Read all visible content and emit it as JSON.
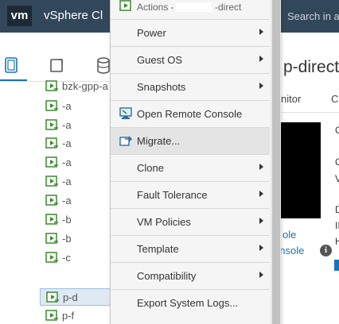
{
  "app": {
    "logo_text": "vm",
    "name": "vSphere Cl",
    "search_placeholder": "Search in a"
  },
  "nav": {
    "icons": [
      "hosts-clusters-icon",
      "vms-templates-icon",
      "storage-icon"
    ]
  },
  "tree": {
    "items": [
      {
        "label": "bzk-gpp-a"
      },
      {
        "label": "-a"
      },
      {
        "label": "-a"
      },
      {
        "label": "-a"
      },
      {
        "label": "-a"
      },
      {
        "label": "-a"
      },
      {
        "label": "-a"
      },
      {
        "label": "-b"
      },
      {
        "label": "-b"
      },
      {
        "label": "-c"
      },
      {
        "label": "p-d"
      },
      {
        "label": "p-f"
      }
    ],
    "selected_index": 10
  },
  "detail": {
    "title": "p-direct",
    "tabs": [
      "nitor",
      "C"
    ],
    "link_console_1": "ole",
    "link_console_2": "onsole",
    "info_glyph": "i",
    "side_letters": [
      "C",
      "C",
      "V",
      "D",
      "II",
      "H"
    ]
  },
  "context_menu": {
    "header": "Actions - ",
    "header_suffix": "-direct",
    "items": [
      {
        "label": "Power",
        "submenu": true,
        "icon": ""
      },
      {
        "label": "Guest OS",
        "submenu": true,
        "icon": ""
      },
      {
        "label": "Snapshots",
        "submenu": true,
        "icon": ""
      },
      {
        "label": "Open Remote Console",
        "submenu": false,
        "icon": "remote-console-icon"
      },
      {
        "label": "Migrate...",
        "submenu": false,
        "icon": "migrate-icon"
      },
      {
        "label": "Clone",
        "submenu": true,
        "icon": ""
      },
      {
        "label": "Fault Tolerance",
        "submenu": true,
        "icon": ""
      },
      {
        "label": "VM Policies",
        "submenu": true,
        "icon": ""
      },
      {
        "label": "Template",
        "submenu": true,
        "icon": ""
      },
      {
        "label": "Compatibility",
        "submenu": true,
        "icon": ""
      },
      {
        "label": "Export System Logs...",
        "submenu": false,
        "icon": ""
      }
    ],
    "hovered_index": 4
  },
  "colors": {
    "topbar": "#33475b",
    "accent": "#1b73b6",
    "menu_bg": "#f5f5f5",
    "hover_bg": "#e4e4e4"
  }
}
